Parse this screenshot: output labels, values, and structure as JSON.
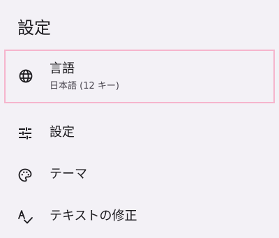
{
  "page": {
    "title": "設定"
  },
  "items": [
    {
      "label": "言語",
      "sublabel": "日本語 (12 キー)",
      "icon": "globe-icon",
      "selected": true
    },
    {
      "label": "設定",
      "icon": "tune-sliders-icon"
    },
    {
      "label": "テーマ",
      "icon": "palette-icon"
    },
    {
      "label": "テキストの修正",
      "icon": "spellcheck-icon"
    }
  ],
  "colors": {
    "background": "#f3f1f6",
    "selection_border": "#f6b5cd",
    "text_primary": "#1c1b1f",
    "text_secondary": "#49454f"
  }
}
